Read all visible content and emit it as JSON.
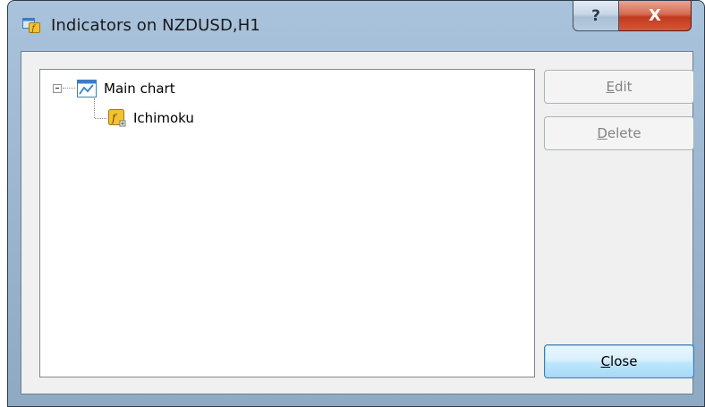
{
  "window": {
    "title": "Indicators on NZDUSD,H1",
    "help_label": "?",
    "close_label": "X"
  },
  "tree": {
    "root": {
      "label": "Main chart",
      "icon": "chart-window-icon",
      "expanded": true,
      "children": [
        {
          "label": "Ichimoku",
          "icon": "custom-indicator-icon"
        }
      ]
    }
  },
  "buttons": {
    "edit": {
      "mnemonic": "E",
      "rest": "dit",
      "enabled": false
    },
    "delete": {
      "mnemonic": "D",
      "rest": "elete",
      "enabled": false
    },
    "close": {
      "mnemonic": "C",
      "rest": "lose",
      "enabled": true
    }
  },
  "colors": {
    "close_button_red": "#c0391d",
    "indicator_icon_yellow": "#f2c230",
    "chart_icon_blue": "#3a7fc4"
  }
}
